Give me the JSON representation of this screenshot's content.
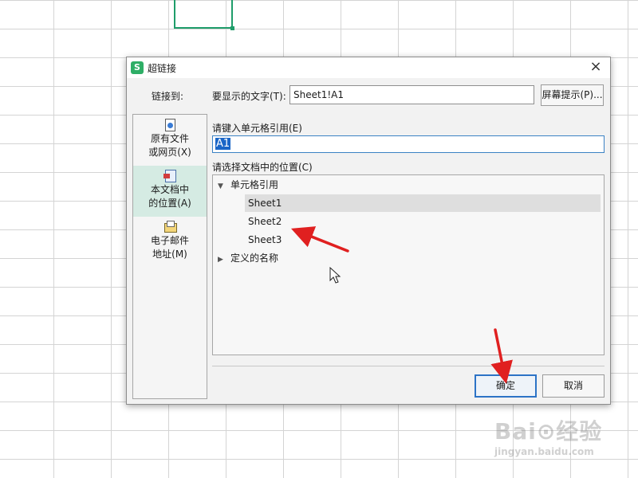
{
  "dialog": {
    "title": "超链接",
    "app_icon_text": "S",
    "close_glyph": "×",
    "link_to_label": "链接到:",
    "display_text_label": "要显示的文字(T):",
    "display_text_value": "Sheet1!A1",
    "screen_tip_label": "屏幕提示(P)...",
    "cell_ref_label": "请键入单元格引用(E)",
    "cell_ref_value": "A1",
    "location_label": "请选择文档中的位置(C)",
    "ok_label": "确定",
    "cancel_label": "取消"
  },
  "link_targets": [
    {
      "line1": "原有文件",
      "line2": "或网页(X)",
      "icon": "document-icon",
      "selected": false
    },
    {
      "line1": "本文档中",
      "line2": "的位置(A)",
      "icon": "document-place-icon",
      "selected": true
    },
    {
      "line1": "电子邮件",
      "line2": "地址(M)",
      "icon": "email-icon",
      "selected": false
    }
  ],
  "tree": {
    "cell_ref_node": "单元格引用",
    "sheets": [
      "Sheet1",
      "Sheet2",
      "Sheet3"
    ],
    "selected_sheet": "Sheet1",
    "defined_names_node": "定义的名称"
  },
  "colors": {
    "accent_green": "#1f9d6a",
    "selection_blue": "#1a66c7",
    "annotation_red": "#e02020"
  },
  "watermark": {
    "brand": "Bai⊙经验",
    "url": "jingyan.baidu.com"
  }
}
